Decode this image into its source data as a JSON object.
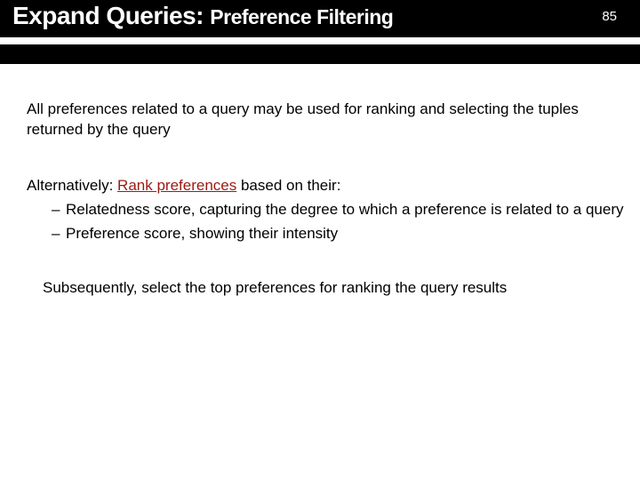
{
  "slide_number": "85",
  "title": {
    "main": "Expand Queries: ",
    "sub": "Preference Filtering"
  },
  "content": {
    "p1": "All preferences related to a query may be used for ranking and selecting the tuples returned by the query",
    "p2_prefix": "Alternatively: ",
    "p2_link": "Rank preferences",
    "p2_suffix": " based on their:",
    "bullets": [
      "Relatedness score, capturing the degree to which a preference is related to a query",
      "Preference score, showing their intensity"
    ],
    "p3": "Subsequently, select the top preferences for ranking the query results"
  }
}
